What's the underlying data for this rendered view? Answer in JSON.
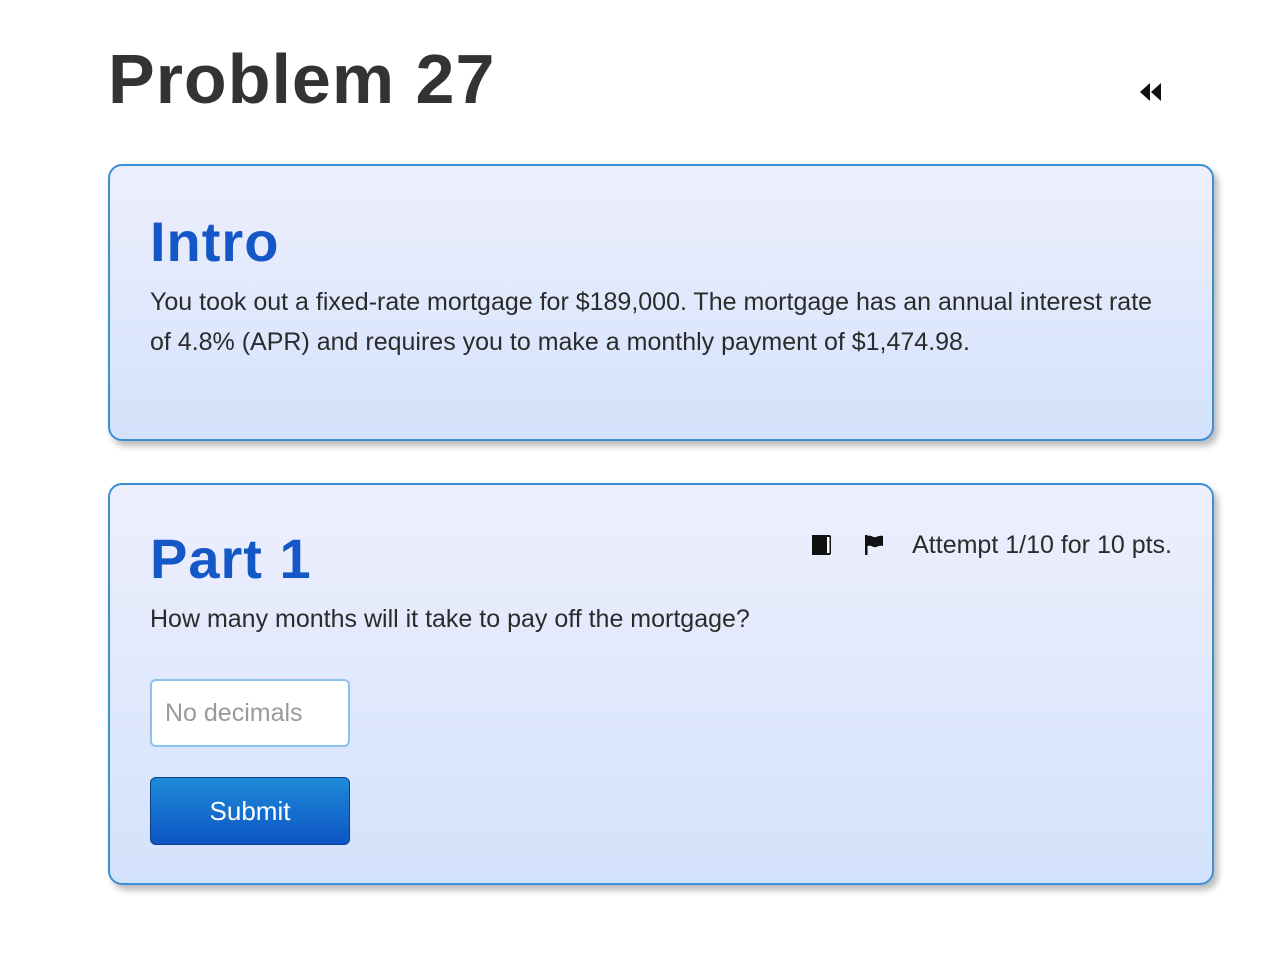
{
  "problem": {
    "title": "Problem 27"
  },
  "intro": {
    "heading": "Intro",
    "text": "You took out a fixed-rate mortgage for $189,000. The mortgage has an annual interest rate of 4.8% (APR) and requires you to make a monthly payment of $1,474.98."
  },
  "part1": {
    "heading": "Part 1",
    "attempt": "Attempt 1/10 for 10 pts.",
    "question": "How many months will it take to pay off the mortgage?",
    "input_value": "",
    "input_placeholder": "No decimals",
    "submit_label": "Submit"
  },
  "icons": {
    "collapse": "double-chevron-left-icon",
    "book": "book-icon",
    "flag": "flag-icon"
  },
  "colors": {
    "heading_blue": "#1458c8",
    "card_border": "#3d8fd4",
    "button_blue": "#0d55c4"
  }
}
